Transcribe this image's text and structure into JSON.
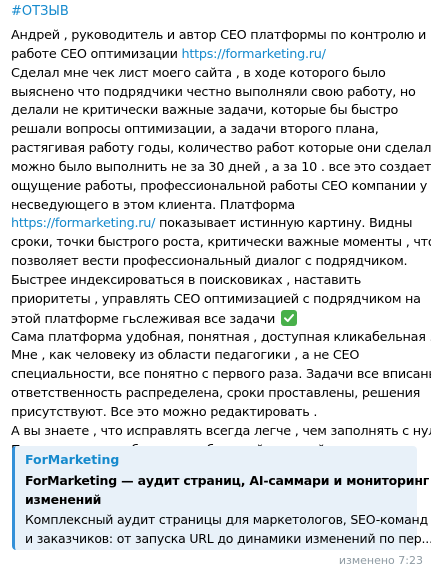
{
  "message": {
    "hashtag": "#ОТЗЫВ",
    "lines": [
      [
        {
          "text": "Андрей , руководитель и автор   СЕО платформы по контролю и"
        }
      ],
      [
        {
          "text": "работе СЕО оптимизации "
        },
        {
          "text": "https://formarketing.ru/",
          "link": true
        }
      ],
      [
        {
          "text": "Сделал мне чек лист моего сайта , в ходе которого было"
        }
      ],
      [
        {
          "text": "выяснено что подрядчики честно выполняли свою работу, но"
        }
      ],
      [
        {
          "text": "делали не критически важные задачи, которые бы быстро"
        }
      ],
      [
        {
          "text": "решали вопросы оптимизации, а задачи второго плана,"
        }
      ],
      [
        {
          "text": "растягивая работу годы, количество работ которые они сделали"
        }
      ],
      [
        {
          "text": "можно было выполнить не за 30 дней , а за 10 . все это создает"
        }
      ],
      [
        {
          "text": "ощущение работы, профессиональной работы СЕО компании у"
        }
      ],
      [
        {
          "text": "несведующего в этом клиента. Платформа"
        }
      ],
      [
        {
          "text": "https://formarketing.ru/",
          "link": true
        },
        {
          "text": " показывает истинную картину. Видны"
        }
      ],
      [
        {
          "text": "сроки, точки быстрого роста, критически важные моменты , что"
        }
      ],
      [
        {
          "text": "позволяет вести профессиональный диалог с подрядчиком."
        }
      ],
      [
        {
          "text": "Быстрее индексироваться в поисковиках , наставить"
        }
      ],
      [
        {
          "text": "приоритеты , управлять СЕО оптимизацией с подрядчиком на"
        }
      ],
      [
        {
          "text": "этой платформе гьслеживая все задачи "
        },
        {
          "emoji": "check-mark"
        }
      ],
      [
        {
          "text": "Сама платформа удобная,  понятная , доступная кликабельная ."
        }
      ],
      [
        {
          "text": "Мне , как человеку из области педагогики , а не СЕО"
        }
      ],
      [
        {
          "text": "специальности, все понятно с первого раза. Задачи все вписаны,"
        }
      ],
      [
        {
          "text": "ответственность распределена, сроки проставлены, решения"
        }
      ],
      [
        {
          "text": "присутствуют. Все это можно редактировать ."
        }
      ],
      [
        {
          "text": "А вы знаете , что исправлять всегда легче , чем заполнять с нуля ."
        }
      ],
      [
        {
          "text": "Поэтому вход в работу очень быстрый и легкий ."
        }
      ]
    ]
  },
  "preview": {
    "site_name": "ForMarketing",
    "title_lines": [
      "ForMarketing — аудит страниц, AI-саммари и мониторинг",
      "изменений"
    ],
    "desc_lines": [
      "Комплексный аудит страницы для маркетологов, SEO-команд",
      "и заказчиков: от запуска URL до динамики изменений по пер..."
    ]
  },
  "meta": {
    "status": "изменено 7:23"
  },
  "colors": {
    "link": "#168acd",
    "preview_bar": "#3390d8",
    "preview_bg": "#e8f1f9",
    "meta": "#8f9ba3",
    "emoji_green": "#48b04a"
  }
}
